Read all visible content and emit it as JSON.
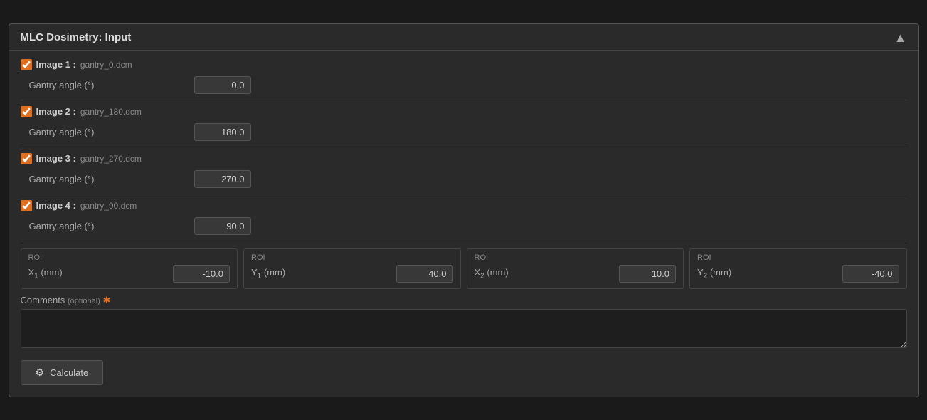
{
  "window": {
    "title": "MLC Dosimetry: Input",
    "collapse_label": "▲"
  },
  "images": [
    {
      "id": "image1",
      "label": "Image 1",
      "filename": "gantry_0.dcm",
      "checked": true,
      "gantry_angle_label": "Gantry angle (°)",
      "gantry_angle_value": "0.0"
    },
    {
      "id": "image2",
      "label": "Image 2",
      "filename": "gantry_180.dcm",
      "checked": true,
      "gantry_angle_label": "Gantry angle (°)",
      "gantry_angle_value": "180.0"
    },
    {
      "id": "image3",
      "label": "Image 3",
      "filename": "gantry_270.dcm",
      "checked": true,
      "gantry_angle_label": "Gantry angle (°)",
      "gantry_angle_value": "270.0"
    },
    {
      "id": "image4",
      "label": "Image 4",
      "filename": "gantry_90.dcm",
      "checked": true,
      "gantry_angle_label": "Gantry angle (°)",
      "gantry_angle_value": "90.0"
    }
  ],
  "roi": {
    "x1": {
      "section_label": "ROI",
      "field_label": "X₁ (mm)",
      "value": "-10.0"
    },
    "y1": {
      "section_label": "ROI",
      "field_label": "Y₁ (mm)",
      "value": "40.0"
    },
    "x2": {
      "section_label": "ROI",
      "field_label": "X₂ (mm)",
      "value": "10.0"
    },
    "y2": {
      "section_label": "ROI",
      "field_label": "Y₂ (mm)",
      "value": "-40.0"
    }
  },
  "comments": {
    "label": "Comments",
    "optional_label": "(optional)",
    "required_marker": "✱",
    "placeholder": "",
    "value": ""
  },
  "calculate_button": {
    "label": "Calculate",
    "gear_icon": "⚙"
  }
}
